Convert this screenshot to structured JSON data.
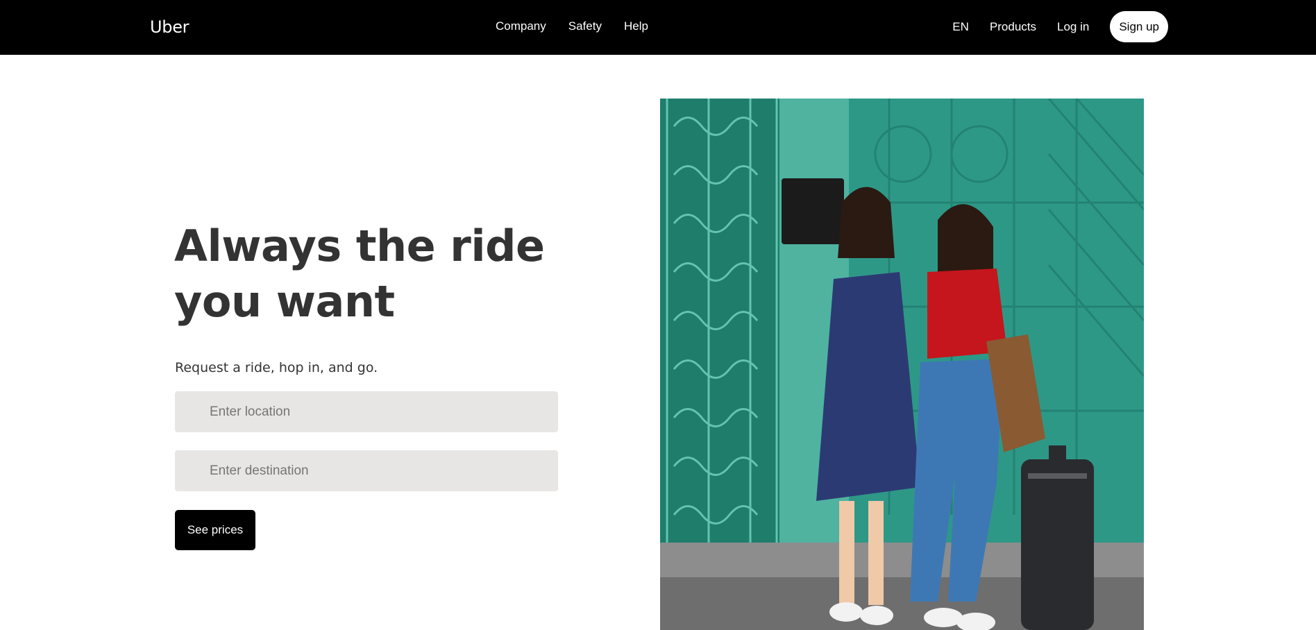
{
  "header": {
    "logo": "Uber",
    "nav_center": [
      {
        "label": "Company"
      },
      {
        "label": "Safety"
      },
      {
        "label": "Help"
      }
    ],
    "language": "EN",
    "products": "Products",
    "login": "Log in",
    "signup": "Sign up"
  },
  "hero": {
    "title": "Always the ride you want",
    "subtitle": "Request a ride, hop in, and go.",
    "location": {
      "value": "",
      "placeholder": "Enter location"
    },
    "destination": {
      "value": "",
      "placeholder": "Enter destination"
    },
    "cta": "See prices",
    "image": {
      "icon": "photo-two-women-with-suitcase"
    }
  },
  "colors": {
    "header_bg": "#000000",
    "text": "#333333",
    "input_bg": "#e8e5e5",
    "button_bg": "#000000",
    "image_teal": "#2f9a86"
  }
}
